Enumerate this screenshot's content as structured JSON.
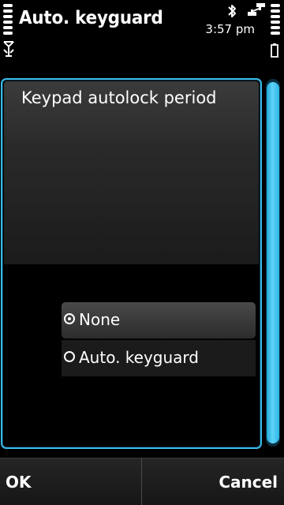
{
  "status_bar": {
    "title": "Auto. keyguard",
    "time": "3:57 pm",
    "icons": {
      "signal": "signal-strength-icon",
      "antenna": "antenna-icon",
      "bluetooth": "bluetooth-icon",
      "network": "network-connection-icon",
      "battery_level": "battery-level-icon",
      "battery": "battery-icon"
    }
  },
  "dialog": {
    "heading": "Keypad autolock period",
    "options": [
      {
        "label": "None",
        "selected": true
      },
      {
        "label": "Auto. keyguard",
        "selected": false
      }
    ]
  },
  "softkeys": {
    "left": "OK",
    "right": "Cancel"
  },
  "colors": {
    "accent": "#39b9e6",
    "background": "#000000",
    "text": "#ffffff"
  }
}
